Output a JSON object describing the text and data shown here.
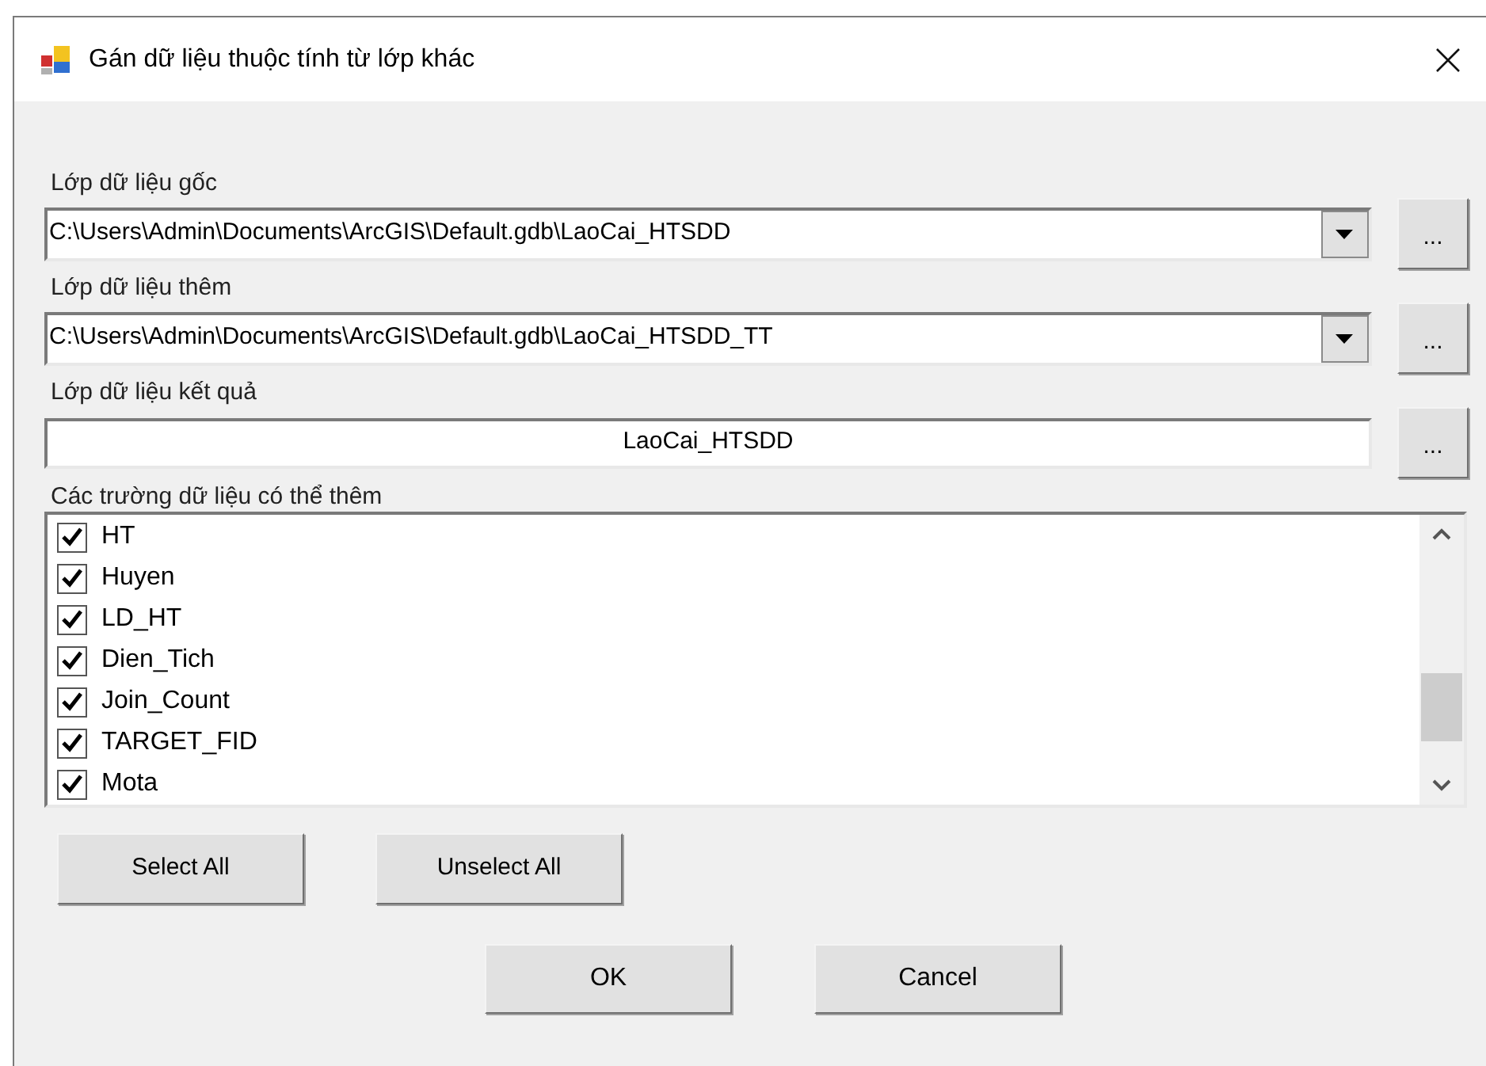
{
  "window": {
    "title": "Gán dữ liệu thuộc tính từ lớp khác"
  },
  "fields": [
    {
      "kind": "combo",
      "label": "Lớp dữ liệu gốc",
      "value": "C:\\Users\\Admin\\Documents\\ArcGIS\\Default.gdb\\LaoCai_HTSDD",
      "browse": "..."
    },
    {
      "kind": "combo",
      "label": "Lớp dữ liệu thêm",
      "value": "C:\\Users\\Admin\\Documents\\ArcGIS\\Default.gdb\\LaoCai_HTSDD_TT",
      "browse": "..."
    },
    {
      "kind": "text",
      "label": "Lớp dữ liệu kết quả",
      "value": "LaoCai_HTSDD",
      "browse": "..."
    }
  ],
  "field_list": {
    "label": "Các trường dữ liệu có thể thêm",
    "items": [
      {
        "label": "HT",
        "checked": true
      },
      {
        "label": "Huyen",
        "checked": true
      },
      {
        "label": "LD_HT",
        "checked": true
      },
      {
        "label": "Dien_Tich",
        "checked": true
      },
      {
        "label": "Join_Count",
        "checked": true
      },
      {
        "label": "TARGET_FID",
        "checked": true
      },
      {
        "label": "Mota",
        "checked": true
      }
    ]
  },
  "selection_buttons": [
    "Select All",
    "Unselect All"
  ],
  "dialog_buttons": [
    "OK",
    "Cancel"
  ]
}
